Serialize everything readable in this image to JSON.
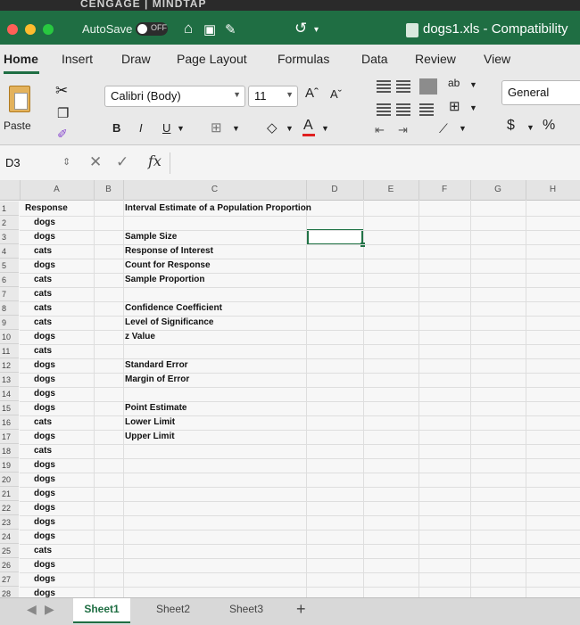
{
  "window": {
    "strip_text": "CENGAGE | MINDTAP",
    "autosave_label": "AutoSave",
    "autosave_state": "OFF",
    "document_title": "dogs1.xls - Compatibility"
  },
  "ribbon": {
    "tabs": [
      "Home",
      "Insert",
      "Draw",
      "Page Layout",
      "Formulas",
      "Data",
      "Review",
      "View"
    ],
    "active_tab": "Home",
    "paste_label": "Paste",
    "font_name": "Calibri (Body)",
    "font_size": "11",
    "grow_font": "Aˆ",
    "shrink_font": "Aˇ",
    "bold": "B",
    "italic": "I",
    "underline": "U",
    "font_color_glyph": "A",
    "number_format": "General",
    "currency": "$",
    "percent": "%"
  },
  "formula_bar": {
    "name_box": "D3",
    "cancel": "✕",
    "enter": "✓",
    "fx": "fx",
    "formula": ""
  },
  "columns": [
    "A",
    "B",
    "C",
    "D",
    "E",
    "F",
    "G",
    "H"
  ],
  "rows": [
    "1",
    "2",
    "3",
    "4",
    "5",
    "6",
    "7",
    "8",
    "9",
    "10",
    "11",
    "12",
    "13",
    "14",
    "15",
    "16",
    "17",
    "18",
    "19",
    "20",
    "21",
    "22",
    "23",
    "24",
    "25",
    "26",
    "27",
    "28"
  ],
  "col_a": [
    "Response",
    "dogs",
    "dogs",
    "cats",
    "dogs",
    "cats",
    "cats",
    "cats",
    "cats",
    "dogs",
    "cats",
    "dogs",
    "dogs",
    "dogs",
    "dogs",
    "cats",
    "dogs",
    "cats",
    "dogs",
    "dogs",
    "dogs",
    "dogs",
    "dogs",
    "dogs",
    "cats",
    "dogs",
    "dogs",
    "dogs"
  ],
  "col_c": {
    "r1": "Interval Estimate of a Population Proportion",
    "r3": "Sample Size",
    "r4": "Response of Interest",
    "r5": "Count for Response",
    "r6": "Sample Proportion",
    "r8": "Confidence Coefficient",
    "r9": "Level of Significance",
    "r10": "z Value",
    "r12": "Standard Error",
    "r13": "Margin of Error",
    "r15": "Point Estimate",
    "r16": "Lower Limit",
    "r17": "Upper Limit"
  },
  "sheets": [
    "Sheet1",
    "Sheet2",
    "Sheet3"
  ],
  "add_sheet": "+",
  "colors": {
    "title_bar": "#1f6e43",
    "accent": "#217346",
    "font_color_bar": "#e02020"
  }
}
